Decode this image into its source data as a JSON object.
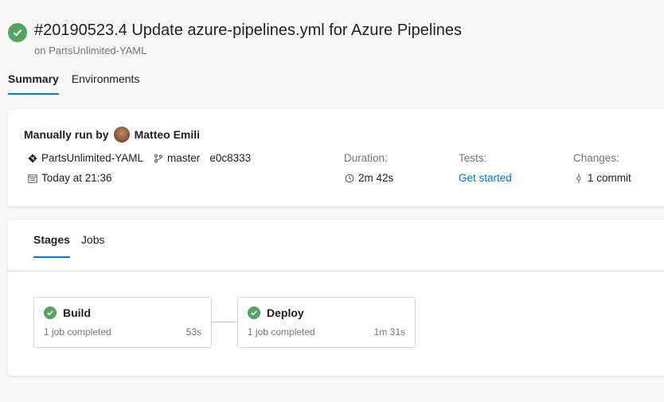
{
  "run": {
    "title": "#20190523.4 Update azure-pipelines.yml for Azure Pipelines",
    "subtitle": "on PartsUnlimited-YAML",
    "status": "succeeded",
    "status_color": "#55a362"
  },
  "tabs": [
    {
      "label": "Summary",
      "active": true
    },
    {
      "label": "Environments",
      "active": false
    }
  ],
  "summary": {
    "run_by_prefix": "Manually run by",
    "user": "Matteo Emili",
    "repo": "PartsUnlimited-YAML",
    "branch": "master",
    "commit": "e0c8333",
    "date": "Today at 21:36",
    "duration_label": "Duration:",
    "duration": "2m 42s",
    "tests_label": "Tests:",
    "tests_link": "Get started",
    "changes_label": "Changes:",
    "changes": "1 commit"
  },
  "stage_tabs": [
    {
      "label": "Stages",
      "active": true
    },
    {
      "label": "Jobs",
      "active": false
    }
  ],
  "stages": [
    {
      "name": "Build",
      "desc": "1 job completed",
      "time": "53s"
    },
    {
      "name": "Deploy",
      "desc": "1 job completed",
      "time": "1m 31s"
    }
  ],
  "colors": {
    "accent": "#0078d4",
    "success": "#55a362"
  }
}
